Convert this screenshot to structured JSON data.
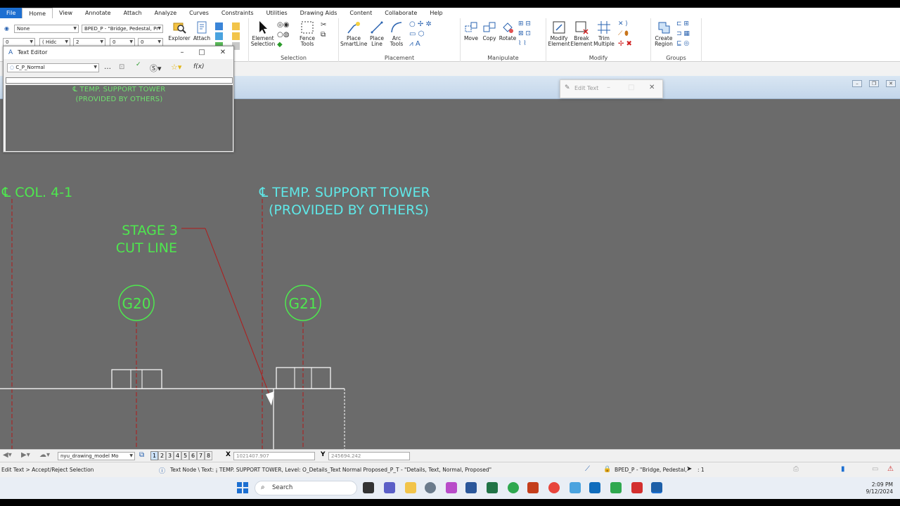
{
  "menu": [
    "File",
    "Home",
    "View",
    "Annotate",
    "Attach",
    "Analyze",
    "Curves",
    "Constraints",
    "Utilities",
    "Drawing Aids",
    "Content",
    "Collaborate",
    "Help"
  ],
  "menu_active": "Home",
  "ribbon": {
    "level_combo": "None",
    "template_combo": "BPED_P - \"Bridge, Pedestal, Pr",
    "weight_combo": "0",
    "style_combo": "( Hidc",
    "line_combo": "2",
    "color_combo": "0",
    "tran_combo": "0",
    "explorer_label": "Explorer",
    "attach_label": "Attach",
    "element_selection_label": "Element Selection",
    "fence_tools_label": "Fence Tools",
    "selection_group": "Selection",
    "place_smartline_label": "Place SmartLine",
    "place_line_label": "Place Line",
    "arc_tools_label": "Arc Tools",
    "placement_group": "Placement",
    "move_label": "Move",
    "copy_label": "Copy",
    "rotate_label": "Rotate",
    "manipulate_group": "Manipulate",
    "modify_element_label": "Modify Element",
    "break_element_label": "Break Element",
    "trim_multiple_label": "Trim Multiple",
    "modify_group": "Modify",
    "create_region_label": "Create Region",
    "groups_group": "Groups"
  },
  "text_editor": {
    "title": "Text Editor",
    "style": "C_P_Normal",
    "line1": "℄ TEMP. SUPPORT TOWER",
    "line2": "(PROVIDED BY OTHERS)"
  },
  "edit_text_dialog": {
    "title": "Edit Text"
  },
  "drawing": {
    "col_label": "℄ COL. 4-1",
    "tower_line1": "℄ TEMP. SUPPORT TOWER",
    "tower_line2": "(PROVIDED BY OTHERS)",
    "stage_line1": "STAGE 3",
    "stage_line2": "CUT LINE",
    "bubble_left": "G20",
    "bubble_right": "G21"
  },
  "viewbar": {
    "model": "nyu_drawing_model Mo",
    "views": [
      "1",
      "2",
      "3",
      "4",
      "5",
      "6",
      "7",
      "8"
    ],
    "x_label": "X",
    "x_value": "1021407.907",
    "y_label": "Y",
    "y_value": "245694.242"
  },
  "status": {
    "prompt": "Edit Text > Accept/Reject Selection",
    "message": "Text Node \\ Text: ¡ TEMP. SUPPORT TOWER, Level: O_Details_Text Normal Proposed_P_T - \"Details, Text, Normal, Proposed\"",
    "level": "BPED_P - \"Bridge, Pedestal,",
    "scale": ": 1"
  },
  "taskbar": {
    "search_placeholder": "Search",
    "time": "2:09 PM",
    "date": "9/12/2024"
  },
  "colors": {
    "canvas": "#6b6b6b",
    "text_green": "#4ee84e",
    "text_cyan": "#5fe8e8",
    "cut_line_red": "#b21a1a",
    "accent_blue": "#1d6fd1"
  }
}
